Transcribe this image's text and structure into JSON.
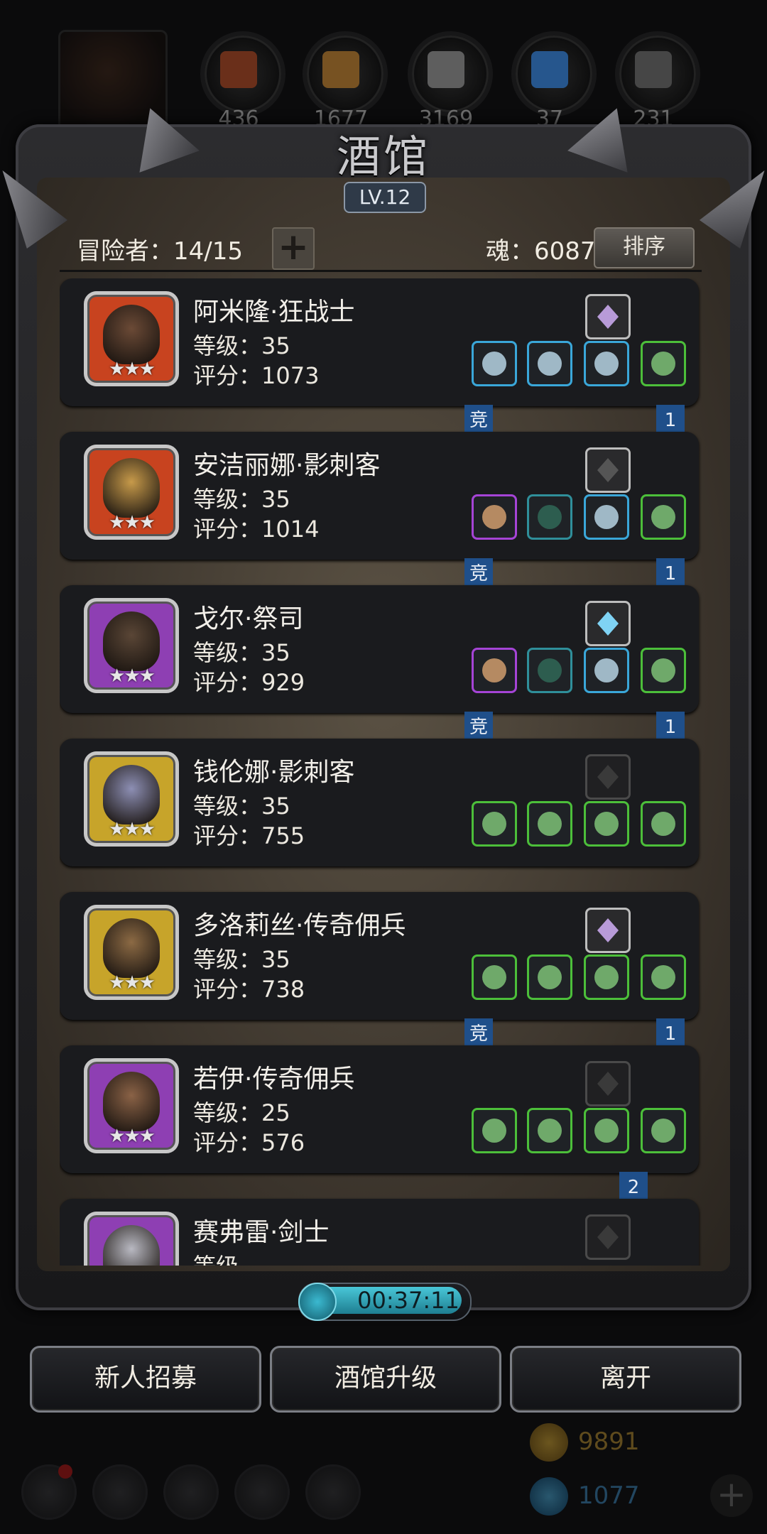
{
  "header": {
    "title": "酒馆",
    "level": "LV.12"
  },
  "resources": [
    {
      "name": "ore-icon",
      "value": "436",
      "color": "#8a3b1f"
    },
    {
      "name": "wood-icon",
      "value": "1677",
      "color": "#9b6a2a"
    },
    {
      "name": "iron-icon",
      "value": "3169",
      "color": "#7a7a7a"
    },
    {
      "name": "crystal-icon",
      "value": "37",
      "color": "#2f6fb8"
    },
    {
      "name": "stone-icon",
      "value": "231",
      "color": "#5a5a5a"
    }
  ],
  "summary": {
    "adventurers": "冒险者：14/15",
    "soul": "魂：6087",
    "sort_label": "排序",
    "add_label": "+"
  },
  "heroes": [
    {
      "name": "阿米隆·狂战士",
      "level": "等级：35",
      "score": "评分：1073",
      "stars": "★★★",
      "frame": "#c8431f",
      "face": "#6b4a36",
      "top_slot": "crystal",
      "equip": [
        "blue",
        "blue",
        "blue",
        "green"
      ],
      "banner_left": "竞",
      "banner_right": "1"
    },
    {
      "name": "安洁丽娜·影刺客",
      "level": "等级：35",
      "score": "评分：1014",
      "stars": "★★★",
      "frame": "#c8431f",
      "face": "#c79a4a",
      "top_slot": "claw",
      "equip": [
        "purple",
        "teal",
        "blue",
        "green"
      ],
      "banner_left": "竞",
      "banner_right": "1"
    },
    {
      "name": "戈尔·祭司",
      "level": "等级：35",
      "score": "评分：929",
      "stars": "★★★",
      "frame": "#8e3fb3",
      "face": "#5a4636",
      "top_slot": "ice",
      "equip": [
        "purple",
        "teal",
        "blue",
        "green"
      ],
      "banner_left": "竞",
      "banner_right": "1"
    },
    {
      "name": "钱伦娜·影刺客",
      "level": "等级：35",
      "score": "评分：755",
      "stars": "★★★",
      "frame": "#c7a42a",
      "face": "#8d8fb4",
      "top_slot": "empty",
      "equip": [
        "green",
        "green",
        "green",
        "green"
      ],
      "banner_left": "",
      "banner_right": ""
    },
    {
      "name": "多洛莉丝·传奇佣兵",
      "level": "等级：35",
      "score": "评分：738",
      "stars": "★★★",
      "frame": "#c7a42a",
      "face": "#8c6a44",
      "top_slot": "crystal",
      "equip": [
        "green",
        "green",
        "green",
        "green"
      ],
      "banner_left": "竞",
      "banner_right": "1"
    },
    {
      "name": "若伊·传奇佣兵",
      "level": "等级：25",
      "score": "评分：576",
      "stars": "★★★",
      "frame": "#8e3fb3",
      "face": "#8a6246",
      "top_slot": "empty",
      "equip": [
        "green",
        "green",
        "green",
        "green"
      ],
      "banner_left": "",
      "banner_right": "2"
    },
    {
      "name": "赛弗雷·剑士",
      "level": "等级",
      "score": "",
      "stars": "",
      "frame": "#8e3fb3",
      "face": "#b9b9c2",
      "top_slot": "empty",
      "equip": [],
      "banner_left": "",
      "banner_right": ""
    }
  ],
  "timer": "00:37:11",
  "buttons": {
    "recruit": "新人招募",
    "upgrade": "酒馆升级",
    "leave": "离开"
  },
  "currency": {
    "gold": "9891",
    "gems": "1077"
  }
}
